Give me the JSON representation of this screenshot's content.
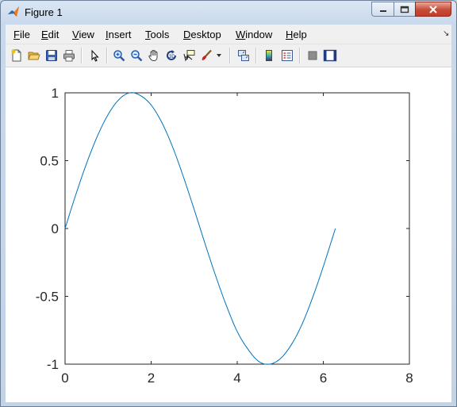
{
  "window": {
    "title": "Figure 1",
    "icons": {
      "app": "matlab-logo-icon",
      "minimize": "minimize-icon",
      "maximize": "maximize-icon",
      "close": "close-icon"
    }
  },
  "menubar": {
    "items": [
      {
        "key": "file",
        "accel": "F",
        "rest": "ile"
      },
      {
        "key": "edit",
        "accel": "E",
        "rest": "dit"
      },
      {
        "key": "view",
        "accel": "V",
        "rest": "iew"
      },
      {
        "key": "insert",
        "accel": "I",
        "rest": "nsert"
      },
      {
        "key": "tools",
        "accel": "T",
        "rest": "ools"
      },
      {
        "key": "desktop",
        "accel": "D",
        "rest": "esktop"
      },
      {
        "key": "window",
        "accel": "W",
        "rest": "indow"
      },
      {
        "key": "help",
        "accel": "H",
        "rest": "elp"
      }
    ],
    "dock_icon": "dock-arrow-icon"
  },
  "toolbar": {
    "icons": [
      "new-figure-icon",
      "open-file-icon",
      "save-icon",
      "print-icon",
      "edit-plot-arrow-icon",
      "zoom-in-icon",
      "zoom-out-icon",
      "pan-hand-icon",
      "rotate-3d-icon",
      "data-cursor-icon",
      "brush-icon",
      "link-plot-icon",
      "insert-colorbar-icon",
      "insert-legend-icon",
      "hide-plot-tools-icon",
      "show-plot-tools-icon"
    ]
  },
  "chart_data": {
    "type": "line",
    "title": "",
    "xlabel": "",
    "ylabel": "",
    "xlim": [
      0,
      8
    ],
    "ylim": [
      -1,
      1
    ],
    "xticks": [
      "0",
      "2",
      "4",
      "6",
      "8"
    ],
    "yticks": [
      "1",
      "0.5",
      "0",
      "-0.5",
      "-1"
    ],
    "grid": false,
    "legend": "none",
    "series": [
      {
        "color": "#0072bd",
        "x": [
          0,
          0.25,
          0.5,
          0.75,
          1.0,
          1.25,
          1.5,
          1.75,
          2.0,
          2.25,
          2.5,
          2.75,
          3.0,
          3.25,
          3.5,
          3.75,
          4.0,
          4.25,
          4.5,
          4.75,
          5.0,
          5.25,
          5.5,
          5.75,
          6.0,
          6.28
        ],
        "y": [
          0,
          0.25,
          0.48,
          0.68,
          0.84,
          0.95,
          1.0,
          0.98,
          0.91,
          0.78,
          0.6,
          0.38,
          0.14,
          -0.11,
          -0.35,
          -0.57,
          -0.76,
          -0.89,
          -0.98,
          -1.0,
          -0.96,
          -0.86,
          -0.71,
          -0.51,
          -0.28,
          0
        ]
      }
    ]
  }
}
